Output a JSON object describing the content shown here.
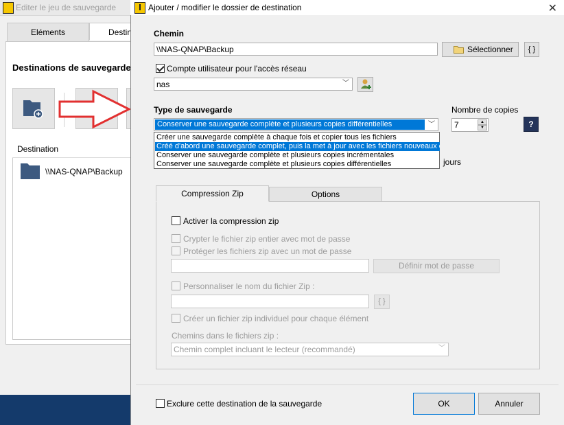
{
  "background_window": {
    "title": "Editer le jeu de sauvegarde",
    "tabs": [
      {
        "label": "Eléments"
      },
      {
        "label": "Destin"
      }
    ],
    "section_title": "Destinations de sauvegarde",
    "list_header": "Destination",
    "list_items": [
      {
        "label": "\\\\NAS-QNAP\\Backup"
      }
    ]
  },
  "dialog": {
    "title": "Ajouter / modifier le dossier de destination",
    "close": "✕",
    "path": {
      "label": "Chemin",
      "value": "\\\\NAS-QNAP\\Backup",
      "select_button": "Sélectionner",
      "vars_button": "{ }"
    },
    "network_account": {
      "checkbox_label": "Compte utilisateur pour l'accès réseau",
      "checked": true,
      "value": "nas"
    },
    "backup_type": {
      "label": "Type de sauvegarde",
      "selected": "Conserver une sauvegarde complète et plusieurs copies différentielles",
      "options": [
        "Créer une sauvegarde complète à chaque fois et copier tous les fichiers",
        "Créé d'abord une sauvegarde complet, puis la met à jour avec les fichiers nouveaux o",
        "Conserver une sauvegarde complète et plusieurs copies incrémentales",
        "Conserver une sauvegarde complète et plusieurs copies différentielles"
      ],
      "highlighted_index": 1
    },
    "copies": {
      "label": "Nombre de copies",
      "value": "7",
      "help": "?"
    },
    "days_label": "jours",
    "tabs": [
      {
        "label": "Compression Zip"
      },
      {
        "label": "Options"
      }
    ],
    "zip": {
      "enable_label": "Activer la compression zip",
      "encrypt_label": "Crypter le fichier zip entier avec mot de passe",
      "protect_label": "Protéger les fichiers zip avec un mot de passe",
      "password_button": "Définir mot de passe",
      "rename_label": "Personnaliser le nom du fichier Zip :",
      "vars_button": "{ }",
      "individual_label": "Créer un fichier zip individuel pour chaque élément",
      "paths_label": "Chemins dans le fichiers zip :",
      "paths_value": "Chemin complet incluant le lecteur (recommandé)"
    },
    "exclude_label": "Exclure cette destination de la sauvegarde",
    "ok": "OK",
    "cancel": "Annuler"
  }
}
